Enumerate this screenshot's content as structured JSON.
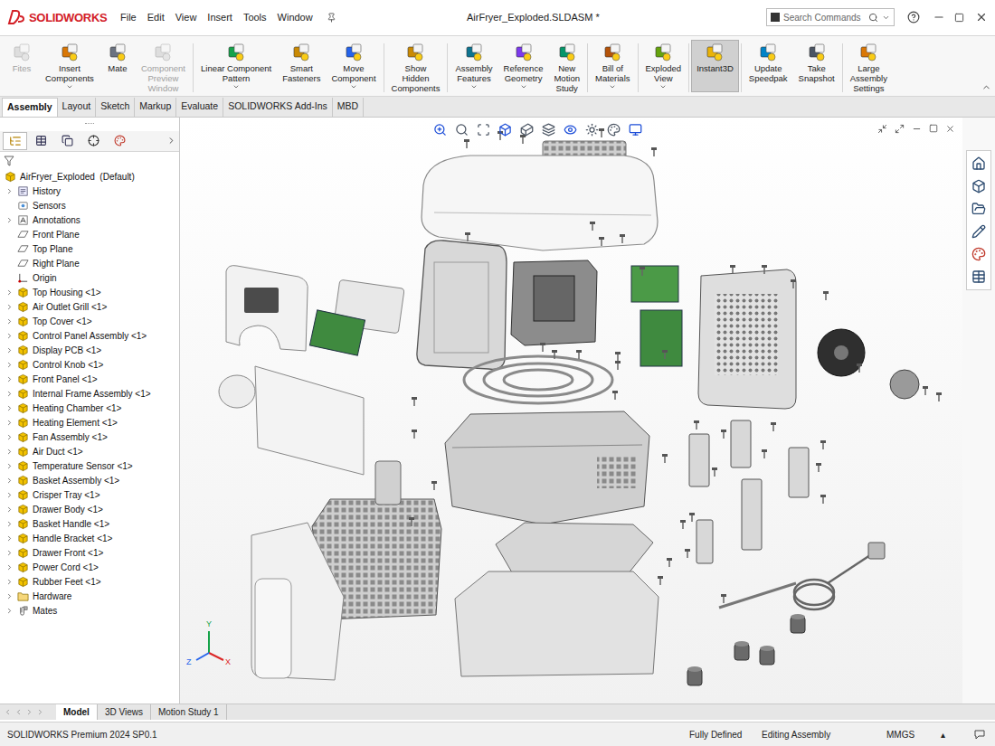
{
  "app": {
    "name": "SOLIDWORKS"
  },
  "menu": [
    "File",
    "Edit",
    "View",
    "Insert",
    "Tools",
    "Window"
  ],
  "window": {
    "title": "AirFryer_Exploded.SLDASM *"
  },
  "search": {
    "placeholder": "Search Commands"
  },
  "ribbon": [
    {
      "lines": [
        "Fites"
      ],
      "disabled": true,
      "dropdown": false,
      "selected": false
    },
    {
      "lines": [
        "Insert",
        "Components"
      ],
      "disabled": false,
      "dropdown": true,
      "selected": false
    },
    {
      "lines": [
        "Mate"
      ],
      "disabled": false,
      "dropdown": false,
      "selected": false
    },
    {
      "lines": [
        "Component",
        "Preview",
        "Window"
      ],
      "disabled": true,
      "dropdown": false,
      "selected": false
    },
    {
      "lines": [
        "Linear Component",
        "Pattern"
      ],
      "disabled": false,
      "dropdown": true,
      "selected": false
    },
    {
      "lines": [
        "Smart",
        "Fasteners"
      ],
      "disabled": false,
      "dropdown": false,
      "selected": false
    },
    {
      "lines": [
        "Move",
        "Component"
      ],
      "disabled": false,
      "dropdown": true,
      "selected": false
    },
    {
      "lines": [
        "Show",
        "Hidden",
        "Components"
      ],
      "disabled": false,
      "dropdown": false,
      "selected": false
    },
    {
      "lines": [
        "Assembly",
        "Features"
      ],
      "disabled": false,
      "dropdown": true,
      "selected": false
    },
    {
      "lines": [
        "Reference",
        "Geometry"
      ],
      "disabled": false,
      "dropdown": true,
      "selected": false
    },
    {
      "lines": [
        "New",
        "Motion",
        "Study"
      ],
      "disabled": false,
      "dropdown": false,
      "selected": false
    },
    {
      "lines": [
        "Bill of",
        "Materials"
      ],
      "disabled": false,
      "dropdown": true,
      "selected": false
    },
    {
      "lines": [
        "Exploded",
        "View"
      ],
      "disabled": false,
      "dropdown": true,
      "selected": false
    },
    {
      "lines": [
        "Instant3D"
      ],
      "disabled": false,
      "dropdown": false,
      "selected": true
    },
    {
      "lines": [
        "Update",
        "Speedpak"
      ],
      "disabled": false,
      "dropdown": false,
      "selected": false
    },
    {
      "lines": [
        "Take",
        "Snapshot"
      ],
      "disabled": false,
      "dropdown": false,
      "selected": false
    },
    {
      "lines": [
        "Large",
        "Assembly",
        "Settings"
      ],
      "disabled": false,
      "dropdown": false,
      "selected": false
    }
  ],
  "command_tabs": [
    {
      "label": "Assembly",
      "selected": true
    },
    {
      "label": "Layout",
      "selected": false
    },
    {
      "label": "Sketch",
      "selected": false
    },
    {
      "label": "Markup",
      "selected": false
    },
    {
      "label": "Evaluate",
      "selected": false
    },
    {
      "label": "SOLIDWORKS Add-Ins",
      "selected": false
    },
    {
      "label": "MBD",
      "selected": false
    }
  ],
  "panel_tabs": [
    {
      "selected": true
    },
    {
      "selected": false
    },
    {
      "selected": false
    },
    {
      "selected": false
    },
    {
      "selected": false
    }
  ],
  "tree": {
    "root": "AirFryer_Exploded  (Default)",
    "items": [
      {
        "label": "History",
        "kind": "history",
        "expandable": true
      },
      {
        "label": "Sensors",
        "kind": "sensors",
        "expandable": false
      },
      {
        "label": "Annotations",
        "kind": "annotations",
        "expandable": true
      },
      {
        "label": "Front Plane",
        "kind": "plane",
        "expandable": false
      },
      {
        "label": "Top Plane",
        "kind": "plane",
        "expandable": false
      },
      {
        "label": "Right Plane",
        "kind": "plane",
        "expandable": false
      },
      {
        "label": "Origin",
        "kind": "origin",
        "expandable": false
      },
      {
        "label": "Top Housing <1>",
        "kind": "component",
        "expandable": true
      },
      {
        "label": "Air Outlet Grill <1>",
        "kind": "component",
        "expandable": true
      },
      {
        "label": "Top Cover <1>",
        "kind": "component",
        "expandable": true
      },
      {
        "label": "Control Panel Assembly <1>",
        "kind": "component",
        "expandable": true
      },
      {
        "label": "Display PCB <1>",
        "kind": "component",
        "expandable": true
      },
      {
        "label": "Control Knob <1>",
        "kind": "component",
        "expandable": true
      },
      {
        "label": "Front Panel <1>",
        "kind": "component",
        "expandable": true
      },
      {
        "label": "Internal Frame Assembly <1>",
        "kind": "component",
        "expandable": true
      },
      {
        "label": "Heating Chamber <1>",
        "kind": "component",
        "expandable": true
      },
      {
        "label": "Heating Element <1>",
        "kind": "component",
        "expandable": true
      },
      {
        "label": "Fan Assembly <1>",
        "kind": "component",
        "expandable": true
      },
      {
        "label": "Air Duct <1>",
        "kind": "component",
        "expandable": true
      },
      {
        "label": "Temperature Sensor <1>",
        "kind": "component",
        "expandable": true
      },
      {
        "label": "Basket Assembly <1>",
        "kind": "component",
        "expandable": true
      },
      {
        "label": "Crisper Tray <1>",
        "kind": "component",
        "expandable": true
      },
      {
        "label": "Drawer Body <1>",
        "kind": "component",
        "expandable": true
      },
      {
        "label": "Basket Handle <1>",
        "kind": "component",
        "expandable": true
      },
      {
        "label": "Handle Bracket <1>",
        "kind": "component",
        "expandable": true
      },
      {
        "label": "Drawer Front <1>",
        "kind": "component",
        "expandable": true
      },
      {
        "label": "Power Cord <1>",
        "kind": "component",
        "expandable": true
      },
      {
        "label": "Rubber Feet <1>",
        "kind": "component",
        "expandable": true
      },
      {
        "label": "Hardware",
        "kind": "folder",
        "expandable": true
      },
      {
        "label": "Mates",
        "kind": "mates",
        "expandable": true
      }
    ]
  },
  "view_tabs": [
    {
      "label": "Model",
      "selected": true
    },
    {
      "label": "3D Views",
      "selected": false
    },
    {
      "label": "Motion Study 1",
      "selected": false
    }
  ],
  "triad": {
    "x": "X",
    "y": "Y",
    "z": "Z"
  },
  "status_bar": {
    "product": "SOLIDWORKS Premium 2024 SP0.1",
    "state": "Fully Defined",
    "mode": "Editing Assembly",
    "units": "MMGS",
    "units_arrow": "▴"
  }
}
